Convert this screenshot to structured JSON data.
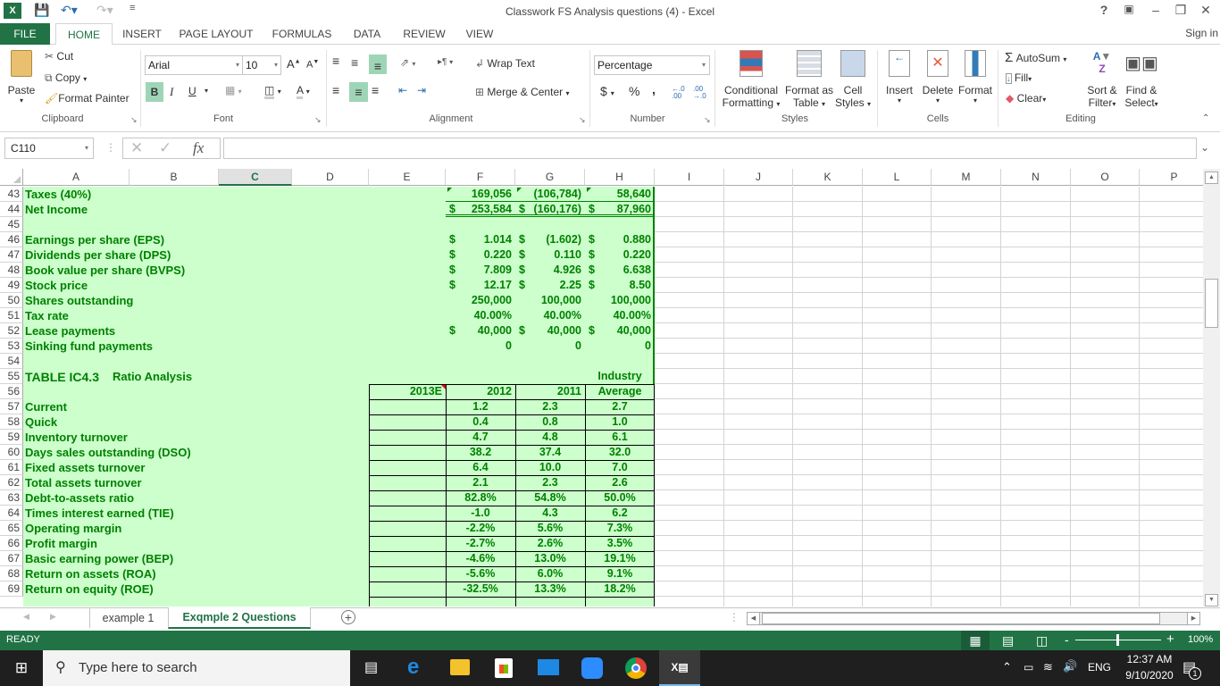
{
  "window": {
    "title": "Classwork FS Analysis questions (4) - Excel",
    "help": "?",
    "sign_in": "Sign in"
  },
  "ribbon_tabs": [
    "FILE",
    "HOME",
    "INSERT",
    "PAGE LAYOUT",
    "FORMULAS",
    "DATA",
    "REVIEW",
    "VIEW"
  ],
  "clipboard": {
    "paste": "Paste",
    "cut": "Cut",
    "copy": "Copy",
    "format_painter": "Format Painter",
    "label": "Clipboard"
  },
  "font": {
    "name": "Arial",
    "size": "10",
    "bold": "B",
    "italic": "I",
    "underline": "U",
    "label": "Font"
  },
  "alignment": {
    "wrap_text": "Wrap Text",
    "merge_center": "Merge & Center",
    "label": "Alignment"
  },
  "number": {
    "format": "Percentage",
    "currency": "$",
    "percent": "%",
    "comma": ",",
    "label": "Number"
  },
  "styles": {
    "conditional": "Conditional",
    "conditional2": "Formatting",
    "format_as": "Format as",
    "table": "Table",
    "cell": "Cell",
    "cell_styles": "Styles",
    "label": "Styles"
  },
  "cells": {
    "insert": "Insert",
    "delete": "Delete",
    "format": "Format",
    "label": "Cells"
  },
  "editing": {
    "autosum": "AutoSum",
    "fill": "Fill",
    "clear": "Clear",
    "sort": "Sort &",
    "filter": "Filter",
    "find": "Find &",
    "select": "Select",
    "label": "Editing"
  },
  "formula_bar": {
    "name_box": "C110",
    "fx": "fx",
    "value": ""
  },
  "columns": [
    "A",
    "B",
    "C",
    "D",
    "E",
    "F",
    "G",
    "H",
    "I",
    "J",
    "K",
    "L",
    "M",
    "N",
    "O",
    "P"
  ],
  "selected_column": "C",
  "rows": [
    {
      "n": "43",
      "label": "Taxes (40%)",
      "f": "169,056",
      "g": "(106,784)",
      "h": "58,640"
    },
    {
      "n": "44",
      "label": "Net Income",
      "f_cur": "$",
      "f": "253,584",
      "g_cur": "$",
      "g": "(160,176)",
      "h_cur": "$",
      "h": "87,960"
    },
    {
      "n": "45",
      "label": ""
    },
    {
      "n": "46",
      "label": "Earnings per share (EPS)",
      "f_cur": "$",
      "f": "1.014",
      "g_cur": "$",
      "g": "(1.602)",
      "h_cur": "$",
      "h": "0.880"
    },
    {
      "n": "47",
      "label": "Dividends per share (DPS)",
      "f_cur": "$",
      "f": "0.220",
      "g_cur": "$",
      "g": "0.110",
      "h_cur": "$",
      "h": "0.220"
    },
    {
      "n": "48",
      "label": "Book value per share (BVPS)",
      "f_cur": "$",
      "f": "7.809",
      "g_cur": "$",
      "g": "4.926",
      "h_cur": "$",
      "h": "6.638"
    },
    {
      "n": "49",
      "label": "Stock price",
      "f_cur": "$",
      "f": "12.17",
      "g_cur": "$",
      "g": "2.25",
      "h_cur": "$",
      "h": "8.50"
    },
    {
      "n": "50",
      "label": "Shares outstanding",
      "f": "250,000",
      "g": "100,000",
      "h": "100,000"
    },
    {
      "n": "51",
      "label": "Tax rate",
      "f": "40.00%",
      "g": "40.00%",
      "h": "40.00%"
    },
    {
      "n": "52",
      "label": "Lease payments",
      "f_cur": "$",
      "f": "40,000",
      "g_cur": "$",
      "g": "40,000",
      "h_cur": "$",
      "h": "40,000"
    },
    {
      "n": "53",
      "label": "Sinking fund payments",
      "f": "0",
      "g": "0",
      "h": "0"
    },
    {
      "n": "54",
      "label": ""
    },
    {
      "n": "55",
      "label": "TABLE IC4.3",
      "label2": "Ratio Analysis",
      "h": "Industry"
    },
    {
      "n": "56",
      "label": "",
      "e": "2013E",
      "f": "2012",
      "g": "2011",
      "h": "Average"
    }
  ],
  "ratios": [
    {
      "n": "57",
      "label": "Current",
      "f": "1.2",
      "g": "2.3",
      "h": "2.7"
    },
    {
      "n": "58",
      "label": "Quick",
      "f": "0.4",
      "g": "0.8",
      "h": "1.0"
    },
    {
      "n": "59",
      "label": "Inventory turnover",
      "f": "4.7",
      "g": "4.8",
      "h": "6.1"
    },
    {
      "n": "60",
      "label": "Days sales outstanding (DSO)",
      "f": "38.2",
      "g": "37.4",
      "h": "32.0"
    },
    {
      "n": "61",
      "label": "Fixed assets turnover",
      "f": "6.4",
      "g": "10.0",
      "h": "7.0"
    },
    {
      "n": "62",
      "label": "Total assets turnover",
      "f": "2.1",
      "g": "2.3",
      "h": "2.6"
    },
    {
      "n": "63",
      "label": "Debt-to-assets ratio",
      "f": "82.8%",
      "g": "54.8%",
      "h": "50.0%"
    },
    {
      "n": "64",
      "label": "Times interest earned (TIE)",
      "f": "-1.0",
      "g": "4.3",
      "h": "6.2"
    },
    {
      "n": "65",
      "label": "Operating margin",
      "f": "-2.2%",
      "g": "5.6%",
      "h": "7.3%"
    },
    {
      "n": "66",
      "label": "Profit margin",
      "f": "-2.7%",
      "g": "2.6%",
      "h": "3.5%"
    },
    {
      "n": "67",
      "label": "Basic earning power (BEP)",
      "f": "-4.6%",
      "g": "13.0%",
      "h": "19.1%"
    },
    {
      "n": "68",
      "label": "Return on assets (ROA)",
      "f": "-5.6%",
      "g": "6.0%",
      "h": "9.1%"
    },
    {
      "n": "69",
      "label": "Return on equity (ROE)",
      "f": "-32.5%",
      "g": "13.3%",
      "h": "18.2%"
    }
  ],
  "sheets": {
    "tabs": [
      "example 1",
      "Exqmple 2 Questions"
    ],
    "active": "Exqmple 2 Questions"
  },
  "status": {
    "ready": "READY",
    "zoom": "100%"
  },
  "taskbar": {
    "search_placeholder": "Type here to search",
    "lang": "ENG",
    "time": "12:37 AM",
    "date": "9/10/2020",
    "notifications": "1"
  },
  "colors": {
    "excel_green": "#217346",
    "cell_fill": "#ccffcc",
    "cell_text": "#008000"
  }
}
